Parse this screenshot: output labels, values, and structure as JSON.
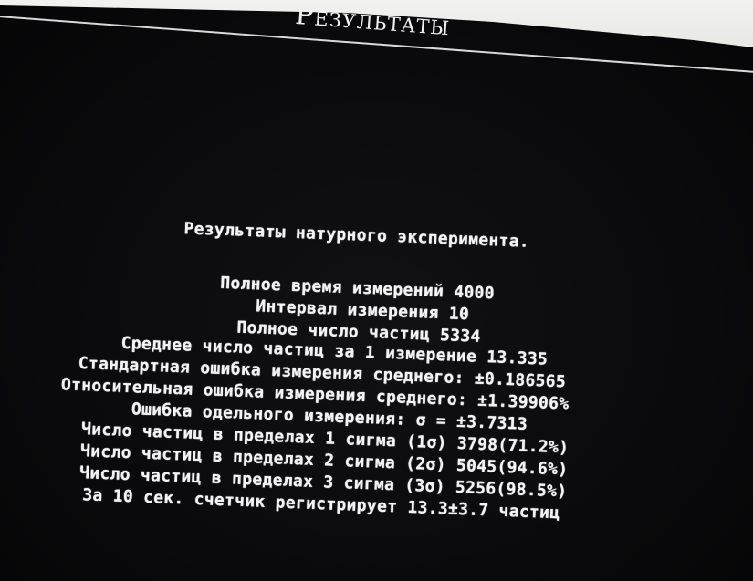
{
  "window": {
    "title": "Результаты"
  },
  "report": {
    "heading": "Результаты натурного эксперимента.",
    "lines": [
      "Полное время измерений 4000",
      "Интервал измерения 10",
      "Полное число частиц 5334",
      "Среднее число частиц за 1 измерение 13.335",
      "Стандартная ошибка измерения среднего: ±0.186565",
      "Относительная ошибка измерения среднего: ±1.39906%",
      "Ошибка одельного измерения: σ = ±3.7313",
      "Число частиц в пределах 1 сигма (1σ) 3798(71.2%)",
      "Число частиц в пределах 2 сигма (2σ) 5045(94.6%)",
      "Число частиц в пределах 3 сигма (3σ) 5256(98.5%)",
      "За 10 сек. счетчик регистрирует 13.3±3.7 частиц"
    ]
  },
  "colors": {
    "background": "#0b0b0d",
    "text": "#f4f4f4",
    "rule": "#d8d8d8"
  }
}
